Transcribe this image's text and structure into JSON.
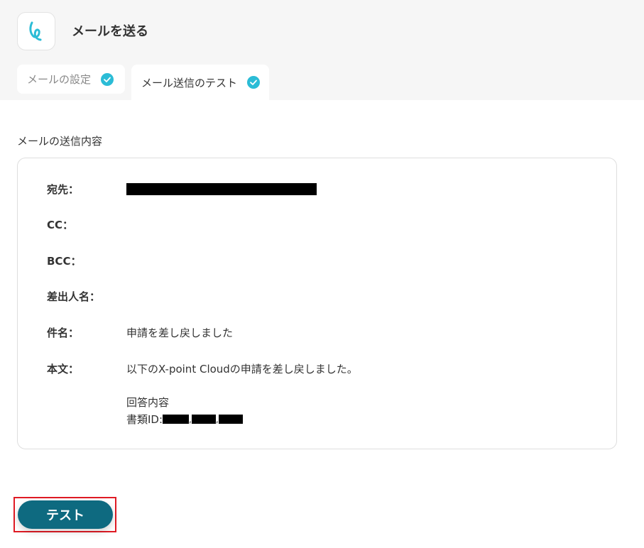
{
  "header": {
    "title": "メールを送る",
    "app_icon": "yoom-logo-icon",
    "accent_color": "#2bbcd6"
  },
  "tabs": [
    {
      "label": "メールの設定",
      "completed": true
    },
    {
      "label": "メール送信のテスト",
      "completed": true,
      "active": true
    }
  ],
  "section": {
    "title": "メールの送信内容"
  },
  "mail": {
    "to_label": "宛先：",
    "to_value": "[redacted]",
    "cc_label": "CC：",
    "cc_value": "",
    "bcc_label": "BCC：",
    "bcc_value": "",
    "sender_label": "差出人名：",
    "sender_value": "",
    "subject_label": "件名：",
    "subject_value": "申請を差し戻しました",
    "body_label": "本文：",
    "body_line1": "以下のX-point Cloudの申請を差し戻しました。",
    "body_line2": "回答内容",
    "body_line3_prefix": "書類ID:"
  },
  "actions": {
    "test_button": "テスト",
    "button_color": "#0e6a80",
    "highlight_color": "#e01b24"
  }
}
